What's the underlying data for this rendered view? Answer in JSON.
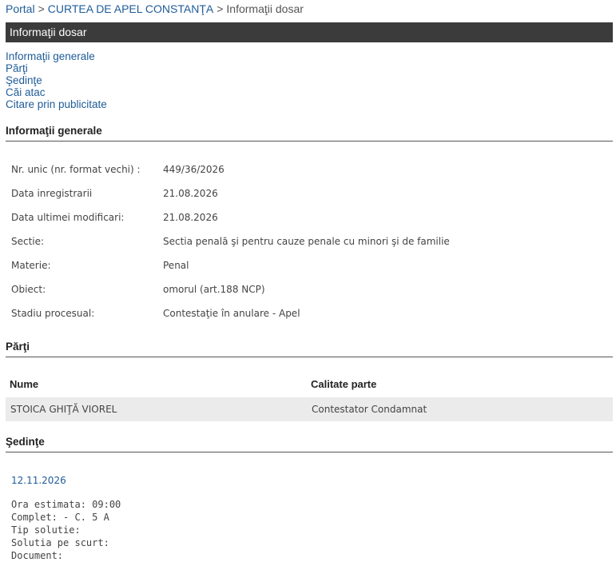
{
  "breadcrumb": {
    "portal": "Portal",
    "court": "CURTEA DE APEL CONSTANŢA",
    "current": "Informaţii dosar",
    "sep": ">"
  },
  "title_bar": "Informaţii dosar",
  "nav_links": [
    "Informaţii generale",
    "Părţi",
    "Şedinţe",
    "Căi atac",
    "Citare prin publicitate"
  ],
  "general": {
    "heading": "Informaţii generale",
    "rows": [
      {
        "label": "Nr. unic (nr. format vechi) :",
        "value": "449/36/2026"
      },
      {
        "label": "Data inregistrarii",
        "value": "21.08.2026"
      },
      {
        "label": "Data ultimei modificari:",
        "value": "21.08.2026"
      },
      {
        "label": "Sectie:",
        "value": "Sectia penală şi pentru cauze penale cu minori şi de familie"
      },
      {
        "label": "Materie:",
        "value": "Penal"
      },
      {
        "label": "Obiect:",
        "value": "omorul (art.188 NCP)"
      },
      {
        "label": "Stadiu procesual:",
        "value": "Contestaţie în anulare - Apel"
      }
    ]
  },
  "parti": {
    "heading": "Părţi",
    "columns": {
      "name": "Nume",
      "role": "Calitate parte"
    },
    "rows": [
      {
        "name": "STOICA GHIŢĂ VIOREL",
        "role": "Contestator Condamnat"
      }
    ]
  },
  "sedinte": {
    "heading": "Şedinţe",
    "date": "12.11.2026",
    "details": [
      "Ora estimata: 09:00",
      "Complet: - C. 5 A",
      "Tip solutie:",
      "Solutia pe scurt:",
      "Document:"
    ]
  }
}
